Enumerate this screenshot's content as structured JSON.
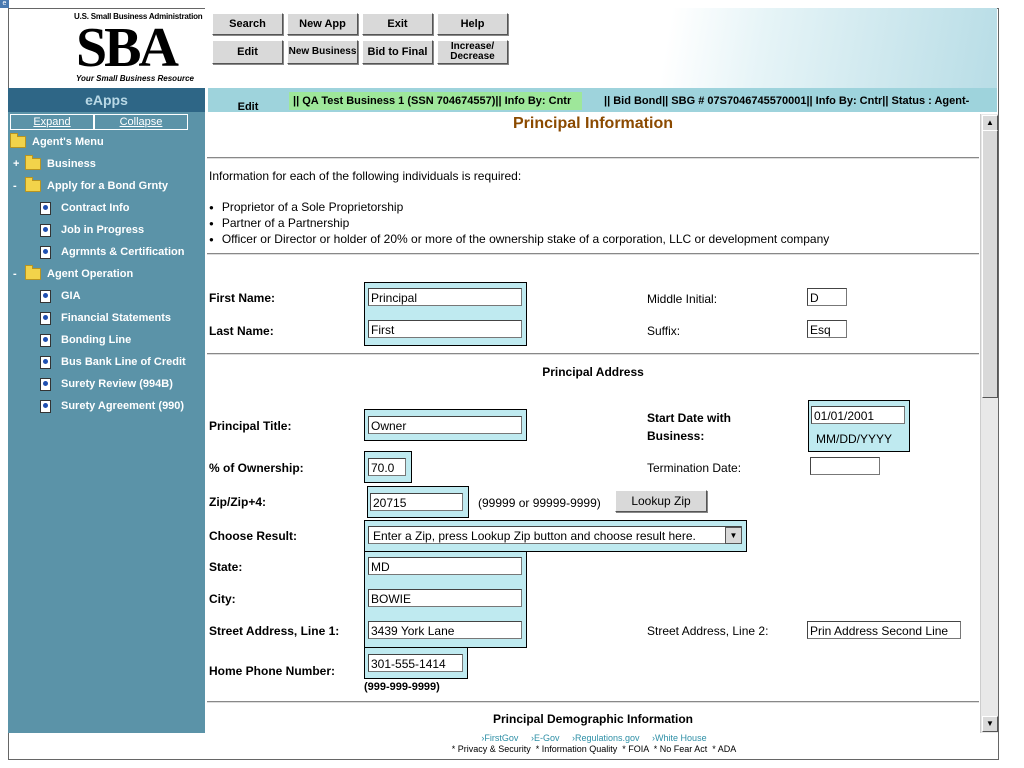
{
  "logo": {
    "top_text": "U.S. Small Business Administration",
    "mark": "SBA",
    "tagline": "Your Small Business Resource"
  },
  "toolbar": {
    "search": "Search",
    "new_app": "New App",
    "exit": "Exit",
    "help": "Help",
    "edit": "Edit",
    "new_business": "New Business",
    "bid_to_final": "Bid to Final",
    "increase_decrease": "Increase/ Decrease"
  },
  "sidebar": {
    "title": "eApps",
    "expand": "Expand",
    "collapse": "Collapse",
    "items": [
      {
        "label": "Agent's Menu",
        "type": "folder",
        "level": 0,
        "toggle": ""
      },
      {
        "label": "Business",
        "type": "folder",
        "level": 1,
        "toggle": "+"
      },
      {
        "label": "Apply for a Bond Grnty",
        "type": "folder",
        "level": 1,
        "toggle": "-"
      },
      {
        "label": "Contract Info",
        "type": "doc",
        "level": 2
      },
      {
        "label": "Job in Progress",
        "type": "doc",
        "level": 2
      },
      {
        "label": "Agrmnts & Certification",
        "type": "doc",
        "level": 2
      },
      {
        "label": "Agent Operation",
        "type": "folder",
        "level": 1,
        "toggle": "-"
      },
      {
        "label": "GIA",
        "type": "doc",
        "level": 2
      },
      {
        "label": "Financial Statements",
        "type": "doc",
        "level": 2
      },
      {
        "label": "Bonding Line",
        "type": "doc",
        "level": 2
      },
      {
        "label": "Bus Bank Line of Credit",
        "type": "doc",
        "level": 2
      },
      {
        "label": "Surety Review (994B)",
        "type": "doc",
        "level": 2
      },
      {
        "label": "Surety Agreement (990)",
        "type": "doc",
        "level": 2
      }
    ]
  },
  "tabs": {
    "edit": "Edit",
    "business": "|| QA Test Business 1 (SSN 704674557)|| Info By:  Cntr",
    "bond": "|| Bid Bond|| SBG # 07S7046745570001|| Info By:  Cntr|| Status :  Agent-"
  },
  "page": {
    "title": "Principal Information",
    "intro": "Information for each of the following individuals is required:",
    "bullets": [
      "Proprietor of a Sole Proprietorship",
      "Partner of a Partnership",
      "Officer or Director or holder of 20% or more of the ownership stake of a corporation, LLC or development company"
    ]
  },
  "form": {
    "first_name_label": "First Name:",
    "first_name": "Principal",
    "middle_initial_label": "Middle Initial:",
    "middle_initial": "D",
    "last_name_label": "Last Name:",
    "last_name": "First",
    "suffix_label": "Suffix:",
    "suffix": "Esq",
    "address_section": "Principal Address",
    "title_label": "Principal Title:",
    "title": "Owner",
    "start_date_label": "Start Date with Business:",
    "start_date": "01/01/2001",
    "start_date_format": "MM/DD/YYYY",
    "ownership_label": "% of Ownership:",
    "ownership": "70.0",
    "termination_label": "Termination Date:",
    "termination": "",
    "zip_label": "Zip/Zip+4:",
    "zip": "20715",
    "zip_hint": "(99999 or 99999-9999)",
    "lookup_zip": "Lookup Zip",
    "choose_result_label": "Choose Result:",
    "choose_result": "Enter a Zip, press Lookup Zip button and choose result here.",
    "state_label": "State:",
    "state": "MD",
    "city_label": "City:",
    "city": "BOWIE",
    "street1_label": "Street Address, Line 1:",
    "street1": "3439 York Lane",
    "street2_label": "Street Address, Line 2:",
    "street2": "Prin Address Second Line",
    "phone_label": "Home Phone Number:",
    "phone": "301-555-1414",
    "phone_hint": "(999-999-9999)",
    "demographic_section": "Principal Demographic Information"
  },
  "footer": {
    "links": [
      "FirstGov",
      "E-Gov",
      "Regulations.gov",
      "White House"
    ],
    "bottom": "* Privacy & Security  * Information Quality  * FOIA  * No Fear Act  * ADA"
  },
  "colors": {
    "sidebar_bg": "#5b93a8",
    "sidebar_title_bg": "#2e6686",
    "tab_bg": "#9ed3dc",
    "business_tab_bg": "#9ee79a",
    "field_highlight": "#bfeaf0",
    "page_title": "#8b4a00"
  }
}
